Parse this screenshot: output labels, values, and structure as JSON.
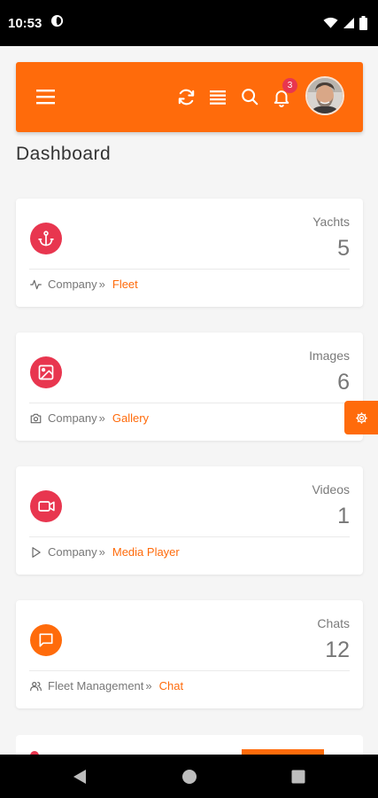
{
  "status_bar": {
    "time": "10:53"
  },
  "header": {
    "notification_count": "3"
  },
  "page": {
    "title": "Dashboard"
  },
  "cards": [
    {
      "label": "Yachts",
      "value": "5",
      "crumb_parent": "Company",
      "crumb_sep": "»",
      "crumb_link": "Fleet",
      "icon": "anchor-icon",
      "icon_color": "#e8364f"
    },
    {
      "label": "Images",
      "value": "6",
      "crumb_parent": "Company",
      "crumb_sep": "»",
      "crumb_link": "Gallery",
      "icon": "image-icon",
      "icon_color": "#e8364f"
    },
    {
      "label": "Videos",
      "value": "1",
      "crumb_parent": "Company",
      "crumb_sep": "»",
      "crumb_link": "Media Player",
      "icon": "video-icon",
      "icon_color": "#e8364f"
    },
    {
      "label": "Chats",
      "value": "12",
      "crumb_parent": "Fleet Management",
      "crumb_sep": "»",
      "crumb_link": "Chat",
      "icon": "chat-icon",
      "icon_color": "#ff6b0b"
    }
  ],
  "colors": {
    "accent": "#ff6b0b",
    "danger": "#e8364f",
    "background": "#f5f5f5"
  }
}
